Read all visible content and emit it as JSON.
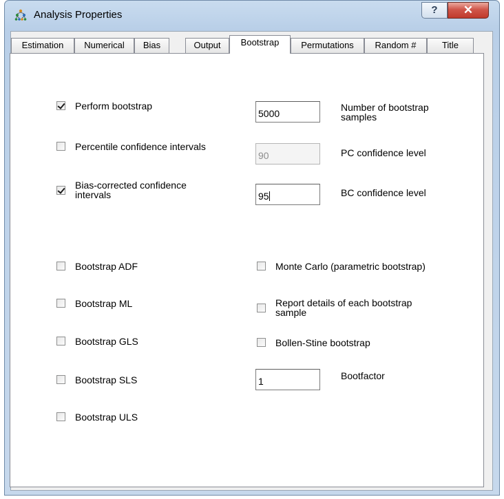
{
  "window": {
    "title": "Analysis Properties",
    "help_label": "?",
    "close_label": "✕"
  },
  "tabs": [
    {
      "label": "Estimation"
    },
    {
      "label": "Numerical"
    },
    {
      "label": "Bias"
    },
    {
      "label": "Output"
    },
    {
      "label": "Bootstrap",
      "active": true
    },
    {
      "label": "Permutations"
    },
    {
      "label": "Random #"
    },
    {
      "label": "Title"
    }
  ],
  "options": {
    "perform_bootstrap": {
      "label": "Perform bootstrap",
      "checked": true
    },
    "percentile_ci": {
      "label": "Percentile confidence intervals",
      "checked": false
    },
    "bias_corrected_ci": {
      "label_line1": "Bias-corrected confidence",
      "label_line2": "intervals",
      "checked": true
    },
    "bootstrap_adf": {
      "label": "Bootstrap ADF",
      "checked": false
    },
    "bootstrap_ml": {
      "label": "Bootstrap ML",
      "checked": false
    },
    "bootstrap_gls": {
      "label": "Bootstrap GLS",
      "checked": false
    },
    "bootstrap_sls": {
      "label": "Bootstrap SLS",
      "checked": false
    },
    "bootstrap_uls": {
      "label": "Bootstrap ULS",
      "checked": false
    },
    "monte_carlo": {
      "label": "Monte Carlo (parametric bootstrap)",
      "checked": false
    },
    "report_details": {
      "label_line1": "Report details of each bootstrap",
      "label_line2": "sample",
      "checked": false
    },
    "bollen_stine": {
      "label": "Bollen-Stine bootstrap",
      "checked": false
    }
  },
  "fields": {
    "num_samples": {
      "value": "5000",
      "label_line1": "Number of bootstrap",
      "label_line2": "samples"
    },
    "pc_level": {
      "value": "90",
      "label": "PC confidence level",
      "disabled": true
    },
    "bc_level": {
      "value": "95",
      "label": "BC confidence level"
    },
    "bootfactor": {
      "value": "1",
      "label": "Bootfactor"
    }
  }
}
